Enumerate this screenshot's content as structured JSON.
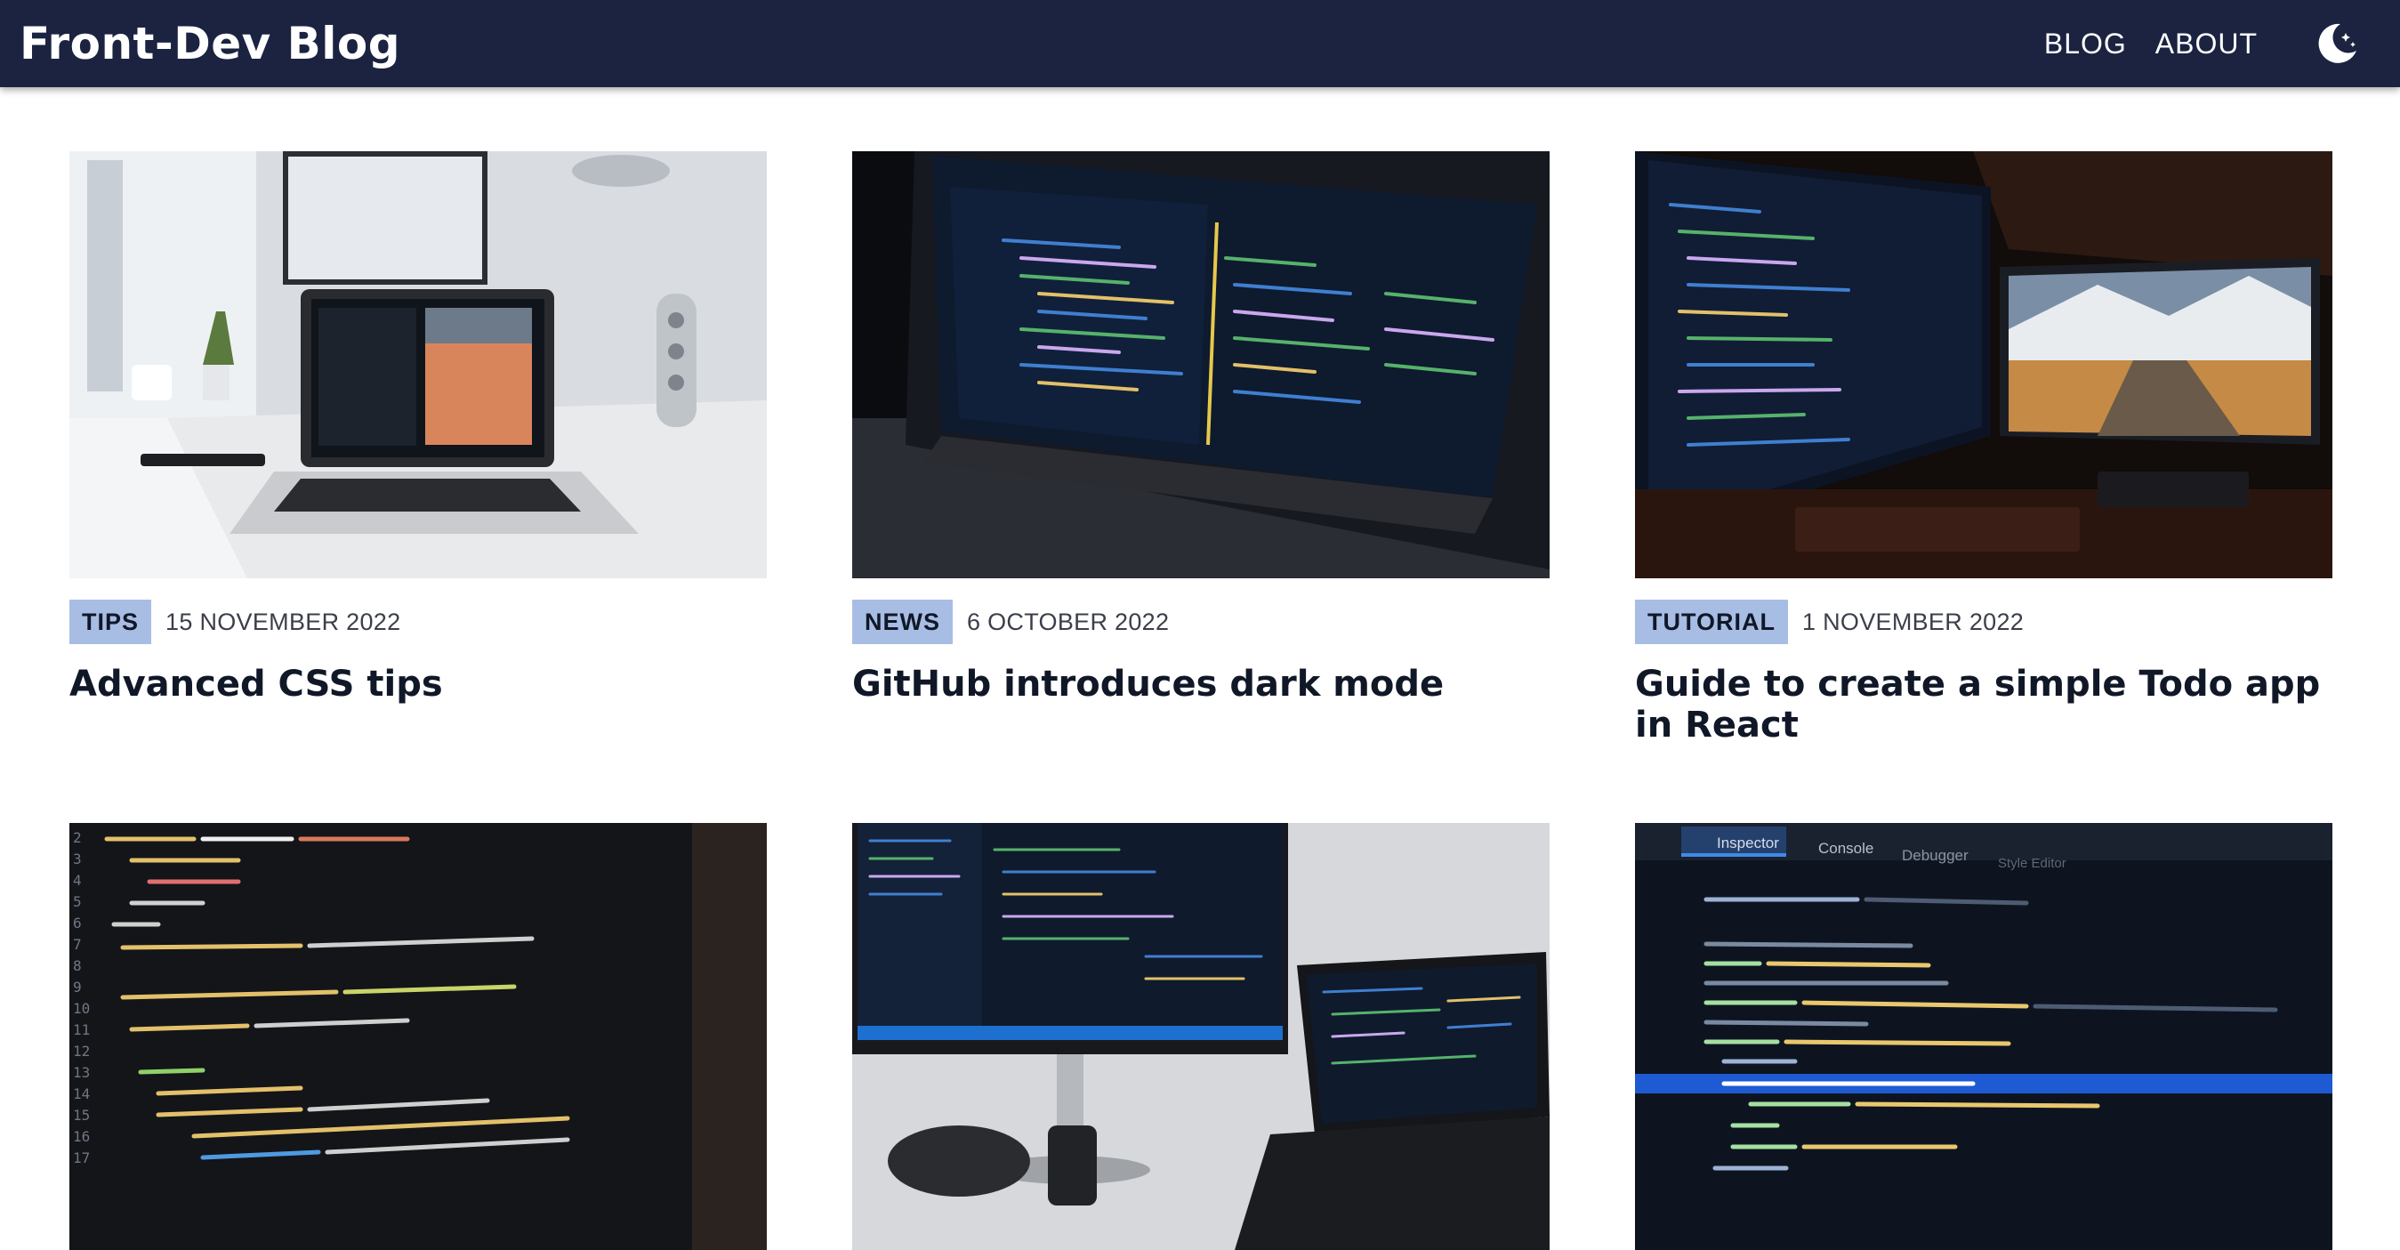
{
  "header": {
    "brand": "Front-Dev Blog",
    "nav": [
      {
        "label": "BLOG"
      },
      {
        "label": "ABOUT"
      }
    ],
    "theme_icon": "moon-stars-icon"
  },
  "colors": {
    "header_bg": "#1b2341",
    "tag_bg": "#a8bde3"
  },
  "posts": [
    {
      "tag": "TIPS",
      "date": "15 NOVEMBER 2022",
      "title": "Advanced CSS tips"
    },
    {
      "tag": "NEWS",
      "date": "6 OCTOBER 2022",
      "title": "GitHub introduces dark mode"
    },
    {
      "tag": "TUTORIAL",
      "date": "1 NOVEMBER 2022",
      "title": "Guide to create a simple Todo app in React"
    },
    {
      "tag": "",
      "date": "",
      "title": ""
    },
    {
      "tag": "",
      "date": "",
      "title": ""
    },
    {
      "tag": "",
      "date": "",
      "title": ""
    }
  ],
  "devtools": {
    "tabs": [
      "Inspector",
      "Console",
      "Debugger",
      "Style Editor"
    ]
  }
}
